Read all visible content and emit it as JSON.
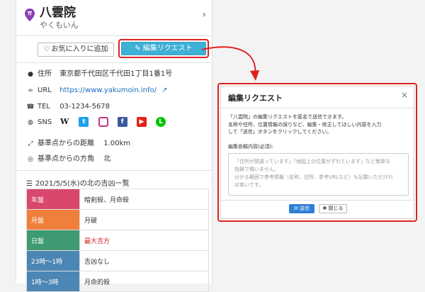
{
  "place": {
    "name": "八雲院",
    "reading": "やくもいん",
    "chevron": "›"
  },
  "actions": {
    "favorite_label": "お気に入りに追加",
    "edit_request_label": "編集リクエスト"
  },
  "info": {
    "address_label": "住所",
    "address_value": "東京都千代田区千代田1丁目1番1号",
    "url_label": "URL",
    "url_value": "https://www.yakumoin.info/",
    "tel_label": "TEL",
    "tel_value": "03-1234-5678",
    "sns_label": "SNS",
    "sns_icons": [
      "wikipedia-icon",
      "twitter-icon",
      "instagram-icon",
      "facebook-icon",
      "youtube-icon",
      "line-icon"
    ],
    "distance_label": "基準点からの距離",
    "distance_value": "1.00km",
    "direction_label": "基準点からの方角",
    "direction_value": "北"
  },
  "fortune": {
    "title": "2021/5/5(水)の北の吉凶一覧",
    "rows": [
      {
        "key": "年盤",
        "value": "暗剣殺、月命殺",
        "color": "#d9476d",
        "highlight": false
      },
      {
        "key": "月盤",
        "value": "月破",
        "color": "#f07f3c",
        "highlight": false
      },
      {
        "key": "日盤",
        "value": "最大吉方",
        "color": "#3e9a72",
        "highlight": true
      },
      {
        "key": "23時〜1時",
        "value": "吉凶なし",
        "color": "#4b86b4",
        "highlight": false
      },
      {
        "key": "1時〜3時",
        "value": "月命的殺",
        "color": "#4b86b4",
        "highlight": false
      }
    ]
  },
  "modal": {
    "title": "編集リクエスト",
    "close": "×",
    "desc_line1": "「八雲院」の編集リクエストを匿名で送信できます。",
    "desc_line2": "名称や住所、位置情報の誤りなど、編集・修正してほしい内容を入力",
    "desc_line3": "して「送信」ボタンをクリックしてください。",
    "field_label": "編集依頼内容(必須):",
    "placeholder_line1": "「住所が間違っています」「地図上の位置がずれています」など簡単な",
    "placeholder_line2": "指摘で構いません。",
    "placeholder_line3": "分かる範囲で参考情報（名称、住所、参考URLなど）も記載いただけれ",
    "placeholder_line4": "ば幸いです。",
    "send_label": "送信",
    "close_button_label": "閉じる"
  },
  "colors": {
    "accent": "#3fb0d6",
    "highlight_border": "#e02020",
    "link": "#1a6fc0",
    "send_button": "#2f7fd6"
  }
}
